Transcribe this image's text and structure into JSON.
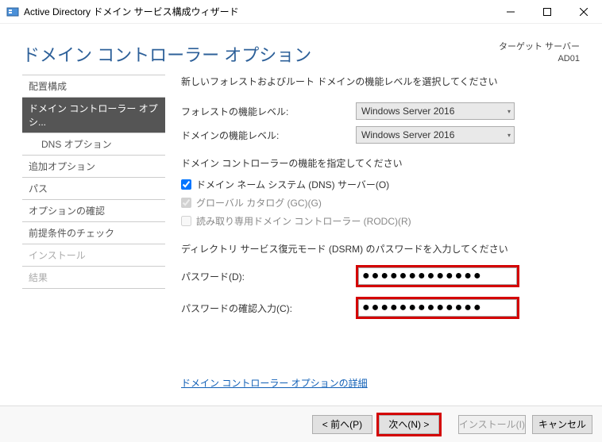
{
  "window": {
    "title": "Active Directory ドメイン サービス構成ウィザード"
  },
  "header": {
    "title": "ドメイン コントローラー オプション",
    "target_label": "ターゲット サーバー",
    "target_value": "AD01"
  },
  "sidebar": {
    "items": [
      {
        "label": "配置構成",
        "active": false
      },
      {
        "label": "ドメイン コントローラー オプシ...",
        "active": true
      },
      {
        "label": "DNS オプション",
        "sub": true
      },
      {
        "label": "追加オプション"
      },
      {
        "label": "パス"
      },
      {
        "label": "オプションの確認"
      },
      {
        "label": "前提条件のチェック"
      },
      {
        "label": "インストール",
        "disabled": true
      },
      {
        "label": "結果",
        "disabled": true
      }
    ]
  },
  "main": {
    "forest_instruction": "新しいフォレストおよびルート ドメインの機能レベルを選択してください",
    "forest_label": "フォレストの機能レベル:",
    "forest_value": "Windows Server 2016",
    "domain_label": "ドメインの機能レベル:",
    "domain_value": "Windows Server 2016",
    "capabilities_instruction": "ドメイン コントローラーの機能を指定してください",
    "dns_label": "ドメイン ネーム システム (DNS) サーバー(O)",
    "gc_label": "グローバル カタログ (GC)(G)",
    "rodc_label": "読み取り専用ドメイン コントローラー (RODC)(R)",
    "dsrm_instruction": "ディレクトリ サービス復元モード (DSRM) のパスワードを入力してください",
    "password_label": "パスワード(D):",
    "password_value": "●●●●●●●●●●●●●",
    "confirm_label": "パスワードの確認入力(C):",
    "confirm_value": "●●●●●●●●●●●●●",
    "more_link": "ドメイン コントローラー オプションの詳細"
  },
  "footer": {
    "prev": "< 前へ(P)",
    "next": "次へ(N) >",
    "install": "インストール(I)",
    "cancel": "キャンセル"
  }
}
